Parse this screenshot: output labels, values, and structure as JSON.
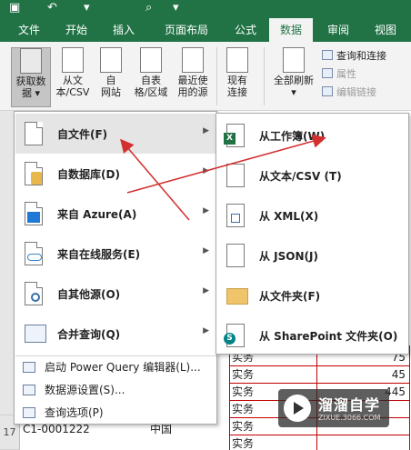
{
  "tabs": [
    {
      "label": "文件"
    },
    {
      "label": "开始"
    },
    {
      "label": "插入"
    },
    {
      "label": "页面布局"
    },
    {
      "label": "公式"
    },
    {
      "label": "数据",
      "active": true
    },
    {
      "label": "审阅"
    },
    {
      "label": "视图"
    }
  ],
  "ribbon": {
    "get_data": {
      "line1": "获取数",
      "line2": "据 ▾"
    },
    "from_text": {
      "line1": "从文",
      "line2": "本/CSV"
    },
    "from_web": {
      "line1": "自",
      "line2": "网站"
    },
    "from_table": {
      "line1": "自表",
      "line2": "格/区域"
    },
    "recent_sources": {
      "line1": "最近使",
      "line2": "用的源"
    },
    "existing_conn": {
      "line1": "现有",
      "line2": "连接"
    },
    "refresh_all": {
      "line1": "全部刷新",
      "line2": "▾"
    },
    "queries_conn": "查询和连接",
    "properties": "属性",
    "edit_links": "编辑链接"
  },
  "menu1": {
    "items": [
      {
        "label": "自文件(F)",
        "icon": "file-icon"
      },
      {
        "label": "自数据库(D)",
        "icon": "database-icon"
      },
      {
        "label": "来自 Azure(A)",
        "icon": "azure-icon"
      },
      {
        "label": "来自在线服务(E)",
        "icon": "cloud-icon"
      },
      {
        "label": "自其他源(O)",
        "icon": "gear-icon"
      },
      {
        "label": "合并查询(Q)",
        "icon": "table-icon"
      }
    ],
    "small_items": [
      {
        "label": "启动 Power Query 编辑器(L)..."
      },
      {
        "label": "数据源设置(S)..."
      },
      {
        "label": "查询选项(P)"
      }
    ]
  },
  "menu2": {
    "items": [
      {
        "label": "从工作簿(W)",
        "icon": "excel-icon"
      },
      {
        "label": "从文本/CSV (T)",
        "icon": "text-file-icon"
      },
      {
        "label": "从 XML(X)",
        "icon": "xml-icon"
      },
      {
        "label": "从 JSON(J)",
        "icon": "json-icon"
      },
      {
        "label": "从文件夹(F)",
        "icon": "folder-icon"
      },
      {
        "label": "从 SharePoint 文件夹(O)",
        "icon": "sharepoint-icon"
      }
    ]
  },
  "sheet": {
    "rows": [
      {
        "c": "实务",
        "n": "75"
      },
      {
        "c": "实务",
        "n": "45"
      },
      {
        "c": "实务",
        "n": "445"
      },
      {
        "c": "实务",
        "n": ""
      },
      {
        "c": "实务",
        "n": ""
      },
      {
        "c": "实务",
        "n": ""
      }
    ],
    "last_row_num": "17",
    "last_row_a": "C1-0001222",
    "last_row_b": "中国"
  },
  "watermark": {
    "title": "溜溜自学",
    "url": "ZIXUE.3066.COM"
  },
  "colors": {
    "excel_green": "#217346",
    "arrow_red": "#d32f2f",
    "grid_red": "#c00000"
  }
}
